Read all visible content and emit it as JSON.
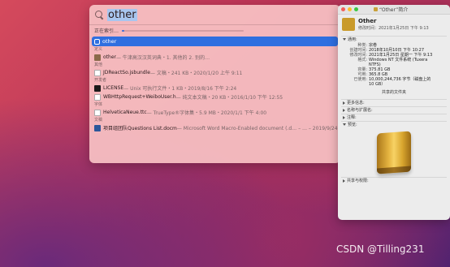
{
  "spotlight": {
    "query": "other",
    "indexing_label": "正在索引…",
    "indexing_progress": 0.02,
    "top_hit": "other",
    "sections": [
      {
        "label": "定义",
        "rows": [
          {
            "icon": "dictionary-icon",
            "name": "other",
            "meta": " — 牛津高汉汉英词典・1. 其他的 2. 别的…"
          }
        ]
      },
      {
        "label": "其他",
        "rows": [
          {
            "icon": "document-icon",
            "name": "JDReactSo.jsbundle",
            "meta": " — 文稿・241 KB・2020/1/20 上午 9:11"
          }
        ]
      },
      {
        "label": "开发者",
        "rows": [
          {
            "icon": "terminal-icon",
            "name": "LICENSE",
            "meta": " — Unix 可执行文件・1 KB・2019/8/16 下午 2:24"
          },
          {
            "icon": "document-icon",
            "name": "WBHttpRequest+WeiboUser.h",
            "meta": " — 纯文本文稿・20 KB・2016/1/10 下午 12:55"
          }
        ]
      },
      {
        "label": "字体",
        "rows": [
          {
            "icon": "font-icon",
            "name": "HelveticaNeue.ttc",
            "meta": " — TrueType®字体集・5.9 MB・2020/1/1 下午 4:00"
          }
        ]
      },
      {
        "label": "文稿",
        "rows": [
          {
            "icon": "word-icon",
            "name": "项目组团队Questions List.docm",
            "meta": " — Microsoft Word Macro-Enabled document (.d… – … – 2019/9/24 下午 2:…"
          }
        ]
      }
    ]
  },
  "info": {
    "window_title": "“Other”简介",
    "name": "Other",
    "modified": "修改时间：2021年1月25日 下午 9:13",
    "general_label": "通用:",
    "general": [
      {
        "k": "种类:",
        "v": "宗卷"
      },
      {
        "k": "创建时间:",
        "v": "2018年10月10日 下午 10:27"
      },
      {
        "k": "修改时间:",
        "v": "2021年1月25日 星期一 下午 9:13"
      },
      {
        "k": "格式:",
        "v": "Windows NT 文件系统 (Tuxera NTFS)"
      },
      {
        "k": "容量:",
        "v": "375.81 GB"
      },
      {
        "k": "可用:",
        "v": "365.8 GB"
      },
      {
        "k": "已使用:",
        "v": "10,000,244,736 字节（磁盘上的 10 GB）"
      }
    ],
    "shared_folder": "共享的文件夹",
    "more_info": "更多信息:",
    "name_ext": "名称与扩展名:",
    "comments": "注释:",
    "preview": "预览:",
    "sharing": "共享与权限:"
  },
  "watermark": "CSDN @Tilling231"
}
